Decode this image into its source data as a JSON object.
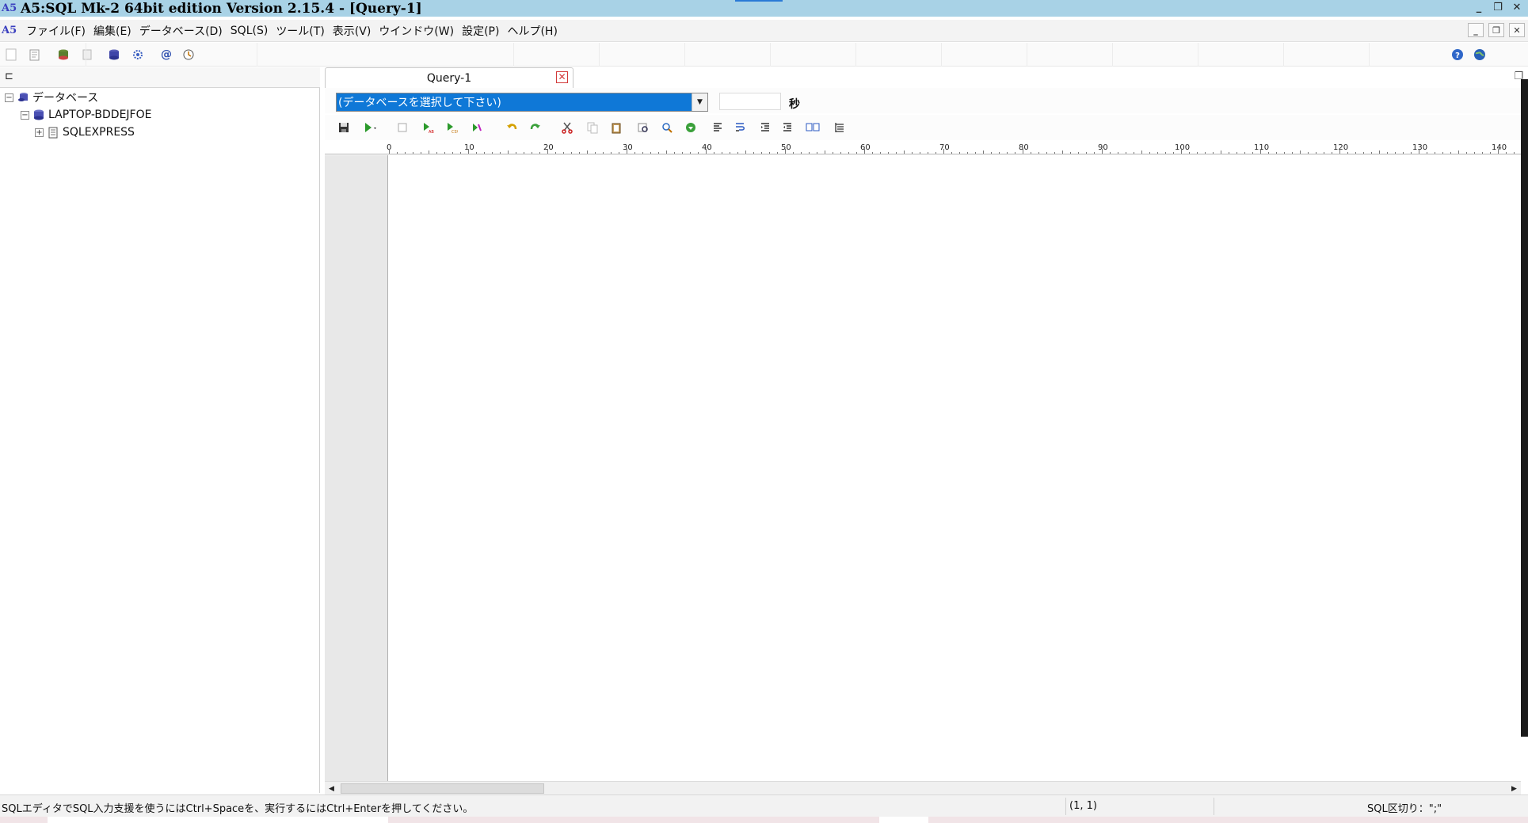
{
  "window": {
    "title": "A5:SQL Mk-2 64bit edition Version 2.15.4 - [Query-1]",
    "app_icon_text": "A5",
    "controls": [
      "_",
      "❐",
      "✕"
    ]
  },
  "menu": {
    "items": [
      "ファイル(F)",
      "編集(E)",
      "データベース(D)",
      "SQL(S)",
      "ツール(T)",
      "表示(V)",
      "ウインドウ(W)",
      "設定(P)",
      "ヘルプ(H)"
    ],
    "mdi_controls": [
      "_",
      "❐",
      "✕"
    ]
  },
  "main_toolbar": {
    "icons": [
      "new-icon",
      "open-icon",
      "db-refresh-icon",
      "copy-db-icon",
      "database-icon",
      "settings-gear-icon",
      "at-sign-icon",
      "clock-icon"
    ],
    "right_icons": [
      "help-icon",
      "web-icon"
    ]
  },
  "tree": {
    "root": "データベース",
    "server": "LAPTOP-BDDEJFOE",
    "instance": "SQLEXPRESS",
    "root_expander": "−",
    "server_expander": "−",
    "instance_expander": "+"
  },
  "query_tab": {
    "label": "Query-1",
    "close_glyph": "✕"
  },
  "db_select": {
    "value": "(データベースを選択して下さい)",
    "timeout_value": "",
    "seconds_label": "秒"
  },
  "query_toolbar": {
    "icons": [
      "save-icon",
      "run-icon",
      "stop-icon",
      "run-abs-icon",
      "run-csv-icon",
      "run-step-icon",
      "undo-icon",
      "redo-icon",
      "cut-icon",
      "copy-icon",
      "paste-icon",
      "find-icon",
      "replace-icon",
      "download-icon",
      "align-left-icon",
      "word-wrap-icon",
      "indent-icon",
      "outdent-icon",
      "compare-icon",
      "tree-outline-icon"
    ]
  },
  "ruler": {
    "labels": [
      "0",
      "10",
      "20",
      "30",
      "40",
      "50",
      "60",
      "70",
      "80",
      "90",
      "100",
      "110",
      "120",
      "130",
      "140"
    ]
  },
  "status": {
    "hint": "SQLエディタでSQL入力支援を使うにはCtrl+Spaceを、実行するにはCtrl+Enterを押してください。",
    "position": "(1, 1)",
    "delimiter": "SQL区切り：\";\""
  },
  "colors": {
    "titlebar": "#a8d2e6",
    "select_highlight": "#0f78d7",
    "tab_close": "#d23a3a"
  }
}
